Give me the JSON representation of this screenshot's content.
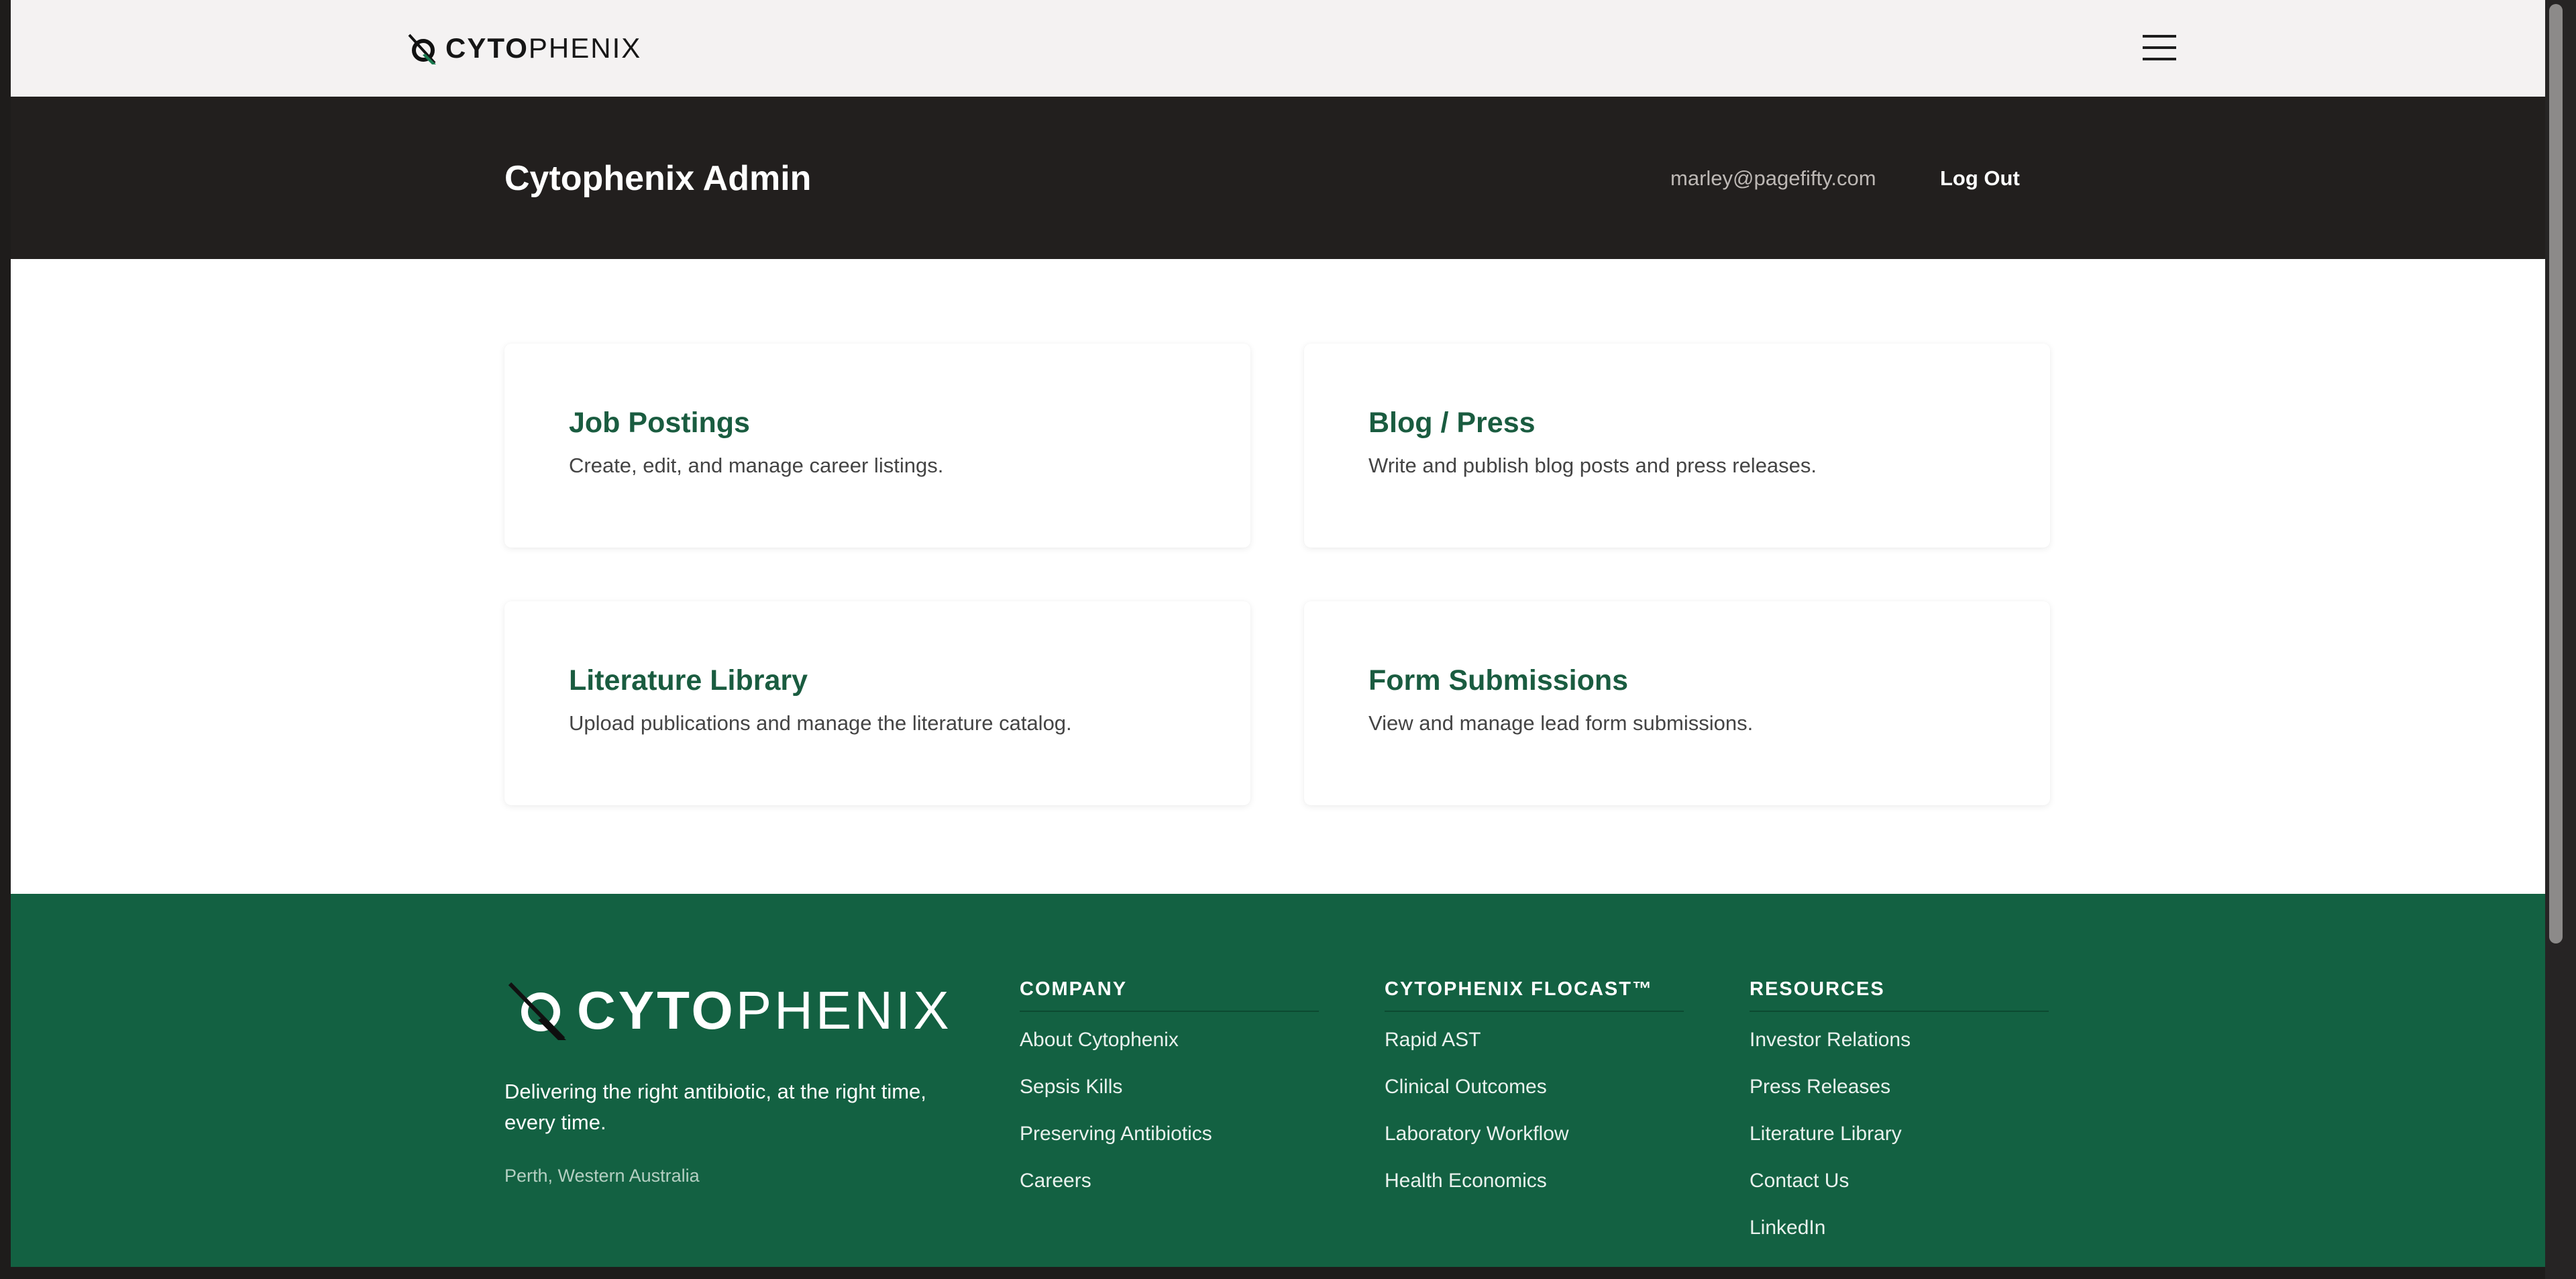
{
  "brand": {
    "name_bold": "CYTO",
    "name_light": "PHENIX",
    "colors": {
      "primary_green": "#136142",
      "heading_green": "#1a5c40",
      "dark": "#221f1e"
    }
  },
  "nav": {
    "menu_icon": "hamburger-menu-icon"
  },
  "admin_bar": {
    "title": "Cytophenix Admin",
    "email": "marley@pagefifty.com",
    "logout_label": "Log Out"
  },
  "cards": [
    {
      "title": "Job Postings",
      "description": "Create, edit, and manage career listings."
    },
    {
      "title": "Blog / Press",
      "description": "Write and publish blog posts and press releases."
    },
    {
      "title": "Literature Library",
      "description": "Upload publications and manage the literature catalog."
    },
    {
      "title": "Form Submissions",
      "description": "View and manage lead form submissions."
    }
  ],
  "footer": {
    "tagline": "Delivering the right antibiotic, at the right time, every time.",
    "location": "Perth, Western Australia",
    "columns": [
      {
        "heading": "COMPANY",
        "links": [
          "About Cytophenix",
          "Sepsis Kills",
          "Preserving Antibiotics",
          "Careers"
        ]
      },
      {
        "heading": "CYTOPHENIX FLOCAST™",
        "links": [
          "Rapid AST",
          "Clinical Outcomes",
          "Laboratory Workflow",
          "Health Economics"
        ]
      },
      {
        "heading": "RESOURCES",
        "links": [
          "Investor Relations",
          "Press Releases",
          "Literature Library",
          "Contact Us",
          "LinkedIn"
        ]
      }
    ]
  }
}
